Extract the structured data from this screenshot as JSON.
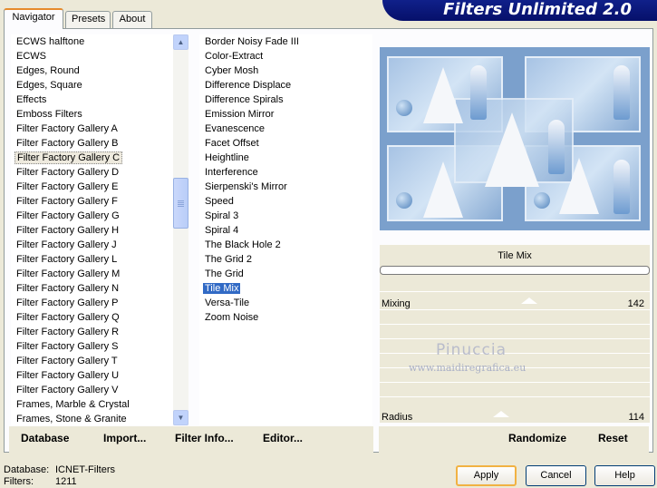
{
  "tabs": [
    "Navigator",
    "Presets",
    "About"
  ],
  "banner_title": "Filters Unlimited 2.0",
  "categories": [
    "ECWS halftone",
    "ECWS",
    "Edges, Round",
    "Edges, Square",
    "Effects",
    "Emboss Filters",
    "Filter Factory Gallery A",
    "Filter Factory Gallery B",
    "Filter Factory Gallery C",
    "Filter Factory Gallery D",
    "Filter Factory Gallery E",
    "Filter Factory Gallery F",
    "Filter Factory Gallery G",
    "Filter Factory Gallery H",
    "Filter Factory Gallery J",
    "Filter Factory Gallery L",
    "Filter Factory Gallery M",
    "Filter Factory Gallery N",
    "Filter Factory Gallery P",
    "Filter Factory Gallery Q",
    "Filter Factory Gallery R",
    "Filter Factory Gallery S",
    "Filter Factory Gallery T",
    "Filter Factory Gallery U",
    "Filter Factory Gallery V",
    "Frames, Marble & Crystal",
    "Frames, Stone & Granite"
  ],
  "selected_category": "Filter Factory Gallery C",
  "filters": [
    "Border Noisy Fade III",
    "Color-Extract",
    "Cyber Mosh",
    "Difference Displace",
    "Difference Spirals",
    "Emission Mirror",
    "Evanescence",
    "Facet Offset",
    "Heightline",
    "Interference",
    "Sierpenski's Mirror",
    "Speed",
    "Spiral 3",
    "Spiral 4",
    "The Black Hole 2",
    "The Grid 2",
    "The Grid",
    "Tile Mix",
    "Versa-Tile",
    "Zoom Noise"
  ],
  "selected_filter": "Tile Mix",
  "filter_name": "Tile Mix",
  "sliders": [
    {
      "label": "Mixing",
      "value": "142",
      "level": 142
    },
    {
      "label": "Radius",
      "value": "114",
      "level": 114
    }
  ],
  "watermark": {
    "name": "Pinuccia",
    "url": "www.maidiregrafica.eu"
  },
  "toolbar": {
    "database": "Database",
    "import": "Import...",
    "filter_info": "Filter Info...",
    "editor": "Editor...",
    "randomize": "Randomize",
    "reset": "Reset"
  },
  "status": {
    "database_label": "Database:",
    "database_value": "ICNET-Filters",
    "filters_label": "Filters:",
    "filters_value": "1211"
  },
  "buttons": {
    "apply": "Apply",
    "cancel": "Cancel",
    "help": "Help"
  },
  "colors": {
    "selection": "#316ac5",
    "banner": "#0a167a",
    "active_tab_accent": "#e68b2c"
  }
}
